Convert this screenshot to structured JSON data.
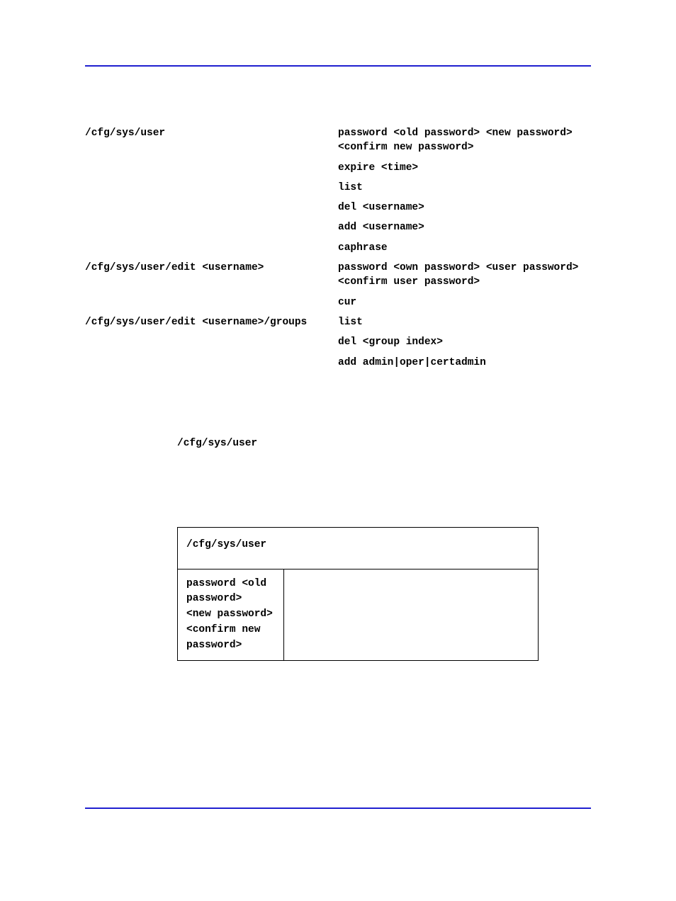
{
  "topCmdRows": [
    {
      "left": "/cfg/sys/user",
      "right": "password <old password> <new password> <confirm new password>"
    },
    {
      "left": "",
      "right": "expire <time>"
    },
    {
      "left": "",
      "right": "list"
    },
    {
      "left": "",
      "right": "del <username>"
    },
    {
      "left": "",
      "right": "add <username>"
    },
    {
      "left": "",
      "right": "caphrase"
    },
    {
      "left": "/cfg/sys/user/edit <username>",
      "right": "password <own password> <user password> <confirm user password>"
    },
    {
      "left": "",
      "right": "cur"
    },
    {
      "left": "/cfg/sys/user/edit <username>/groups",
      "right": "list"
    },
    {
      "left": "",
      "right": "del <group index>"
    },
    {
      "left": "",
      "right": "add admin|oper|certadmin"
    }
  ],
  "midCommand": "/cfg/sys/user",
  "boxHeader": "/cfg/sys/user",
  "boxCell1": "password <old password>\n<new password>\n<confirm new password>"
}
